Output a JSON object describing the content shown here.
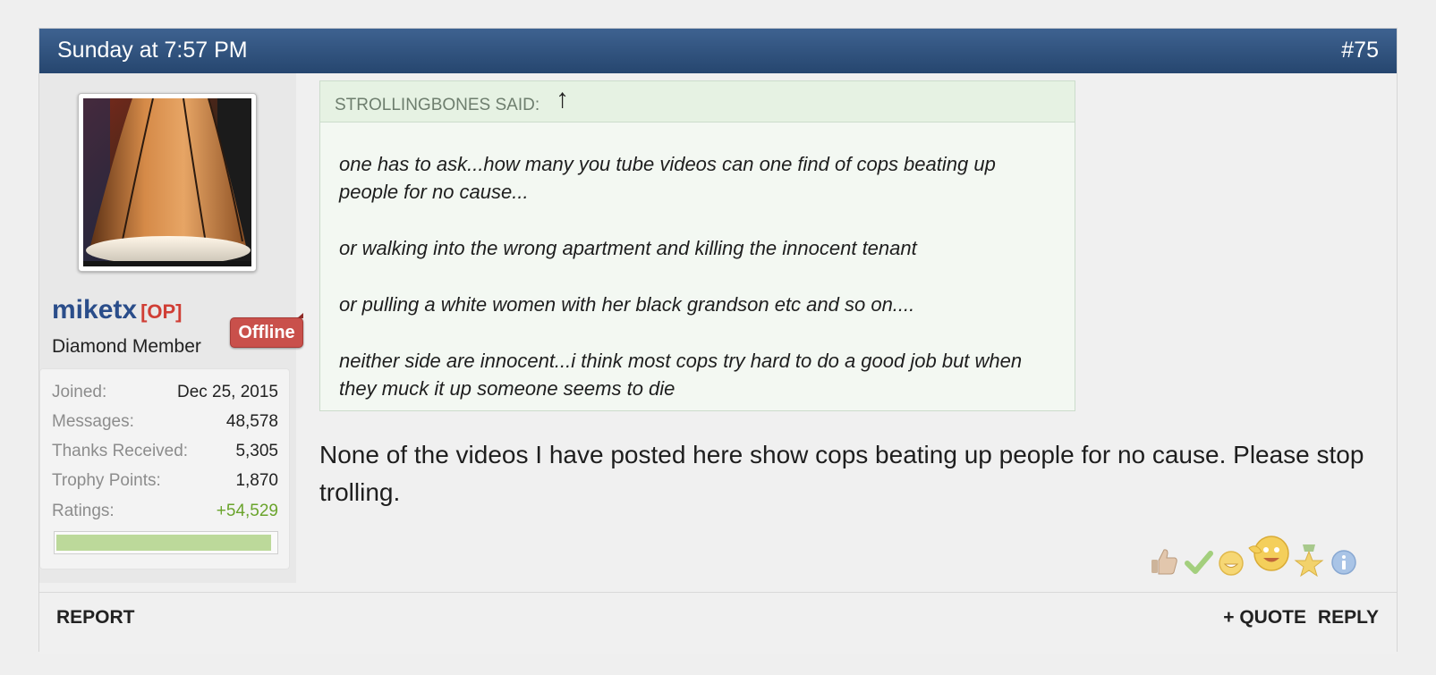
{
  "post": {
    "date": "Sunday at 7:57 PM",
    "number": "#75"
  },
  "user": {
    "avatar_icon": "lamp-shade-avatar",
    "status_badge": "Offline",
    "username": "miketx",
    "op_tag": "[OP]",
    "title": "Diamond Member",
    "stats": [
      {
        "label": "Joined:",
        "value": "Dec 25, 2015"
      },
      {
        "label": "Messages:",
        "value": "48,578"
      },
      {
        "label": "Thanks Received:",
        "value": "5,305"
      },
      {
        "label": "Trophy Points:",
        "value": "1,870"
      },
      {
        "label": "Ratings:",
        "value": "+54,529"
      }
    ],
    "rating_bar_fill": 0.98
  },
  "quote": {
    "author": "STROLLINGBONES SAID:",
    "arrow": "↑",
    "paragraphs": [
      "one has to ask...how many you tube videos can one find of cops beating up people for no cause...",
      "or walking into the wrong apartment and killing the innocent tenant",
      "or pulling a white women with her black grandson etc and so on....",
      "neither side are innocent...i think most cops try hard to do a good job but when they muck it up someone seems to die"
    ]
  },
  "message": "None of the videos I have posted here show cops beating up people for no cause. Please stop trolling.",
  "reactions": [
    "thumbs-up-icon",
    "checkmark-icon",
    "smiley-icon",
    "laughing-icon",
    "trophy-star-icon",
    "info-icon"
  ],
  "footer": {
    "report": "REPORT",
    "quote": "+ QUOTE",
    "reply": "REPLY"
  },
  "colors": {
    "header": "#2c4c77",
    "username": "#2a4d8a",
    "op_tag": "#d03e35",
    "offline_badge": "#c9504b",
    "rating_positive": "#6aa42c"
  }
}
